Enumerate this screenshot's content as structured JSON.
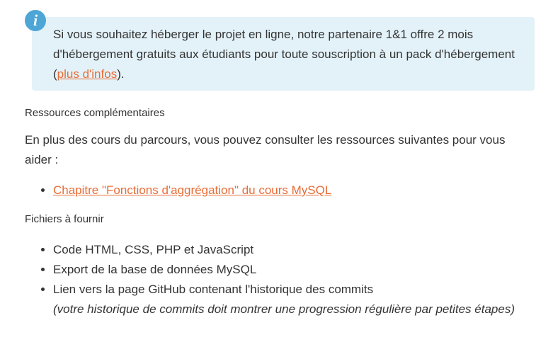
{
  "info": {
    "text_before": "Si vous souhaitez héberger le projet en ligne, notre partenaire 1&1 offre 2 mois d'hébergement gratuits aux étudiants pour toute souscription à un pack d'hébergement (",
    "link_label": "plus d'infos",
    "text_after": ").",
    "icon": "info-icon",
    "icon_glyph": "i"
  },
  "resources": {
    "title": "Ressources complémentaires",
    "intro": "En plus des cours du parcours, vous pouvez consulter les ressources suivantes pour vous aider :",
    "items": [
      {
        "label": "Chapitre \"Fonctions d'aggrégation\" du cours MySQL"
      }
    ]
  },
  "files": {
    "title": "Fichiers à fournir",
    "items": [
      {
        "label": "Code HTML, CSS, PHP et JavaScript"
      },
      {
        "label": "Export de la base de données MySQL"
      },
      {
        "label": "Lien vers la page GitHub contenant l'historique des commits",
        "note": "(votre historique de commits doit montrer une progression régulière par petites étapes)"
      }
    ]
  },
  "colors": {
    "accent_link": "#e86c35",
    "info_background": "#e3f2f8",
    "info_icon": "#4da6d6"
  }
}
